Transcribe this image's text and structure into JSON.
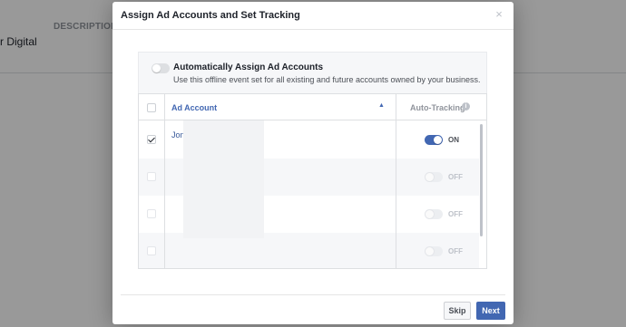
{
  "background": {
    "column_header": "DESCRIPTION",
    "name_fragment": "r Digital"
  },
  "dialog": {
    "title": "Assign Ad Accounts and Set Tracking",
    "close_glyph": "×"
  },
  "auto_assign": {
    "enabled": false,
    "title": "Automatically Assign Ad Accounts",
    "description": "Use this offline event set for all existing and future accounts owned by your business."
  },
  "table": {
    "columns": {
      "account": "Ad Account",
      "tracking": "Auto-Tracking"
    },
    "rows": [
      {
        "checked": true,
        "name": "Jon Loomer Digital",
        "tracking_on": true,
        "tracking_label": "ON"
      },
      {
        "checked": false,
        "name": "",
        "tracking_on": false,
        "tracking_label": "OFF"
      },
      {
        "checked": false,
        "name": "",
        "tracking_on": false,
        "tracking_label": "OFF"
      },
      {
        "checked": false,
        "name": "",
        "tracking_on": false,
        "tracking_label": "OFF"
      }
    ]
  },
  "footer": {
    "skip_label": "Skip",
    "next_label": "Next"
  },
  "colors": {
    "accent": "#4267b2",
    "link": "#365899"
  }
}
